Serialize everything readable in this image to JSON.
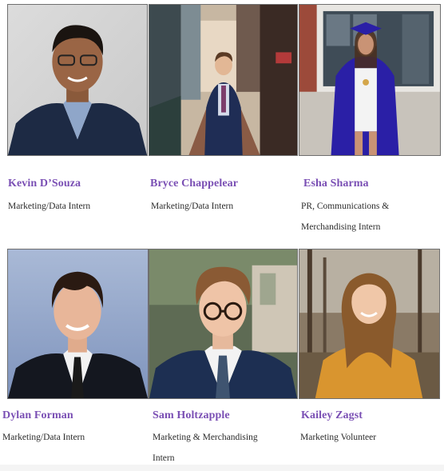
{
  "team": {
    "members": [
      {
        "name": "Kevin D’Souza",
        "role_lines": [
          "Marketing/Data Intern"
        ]
      },
      {
        "name": "Bryce Chappelear",
        "role_lines": [
          "Marketing/Data Intern"
        ]
      },
      {
        "name": "Esha Sharma",
        "role_lines": [
          "PR, Communications &",
          "Merchandising Intern"
        ]
      },
      {
        "name": "Dylan Forman",
        "role_lines": [
          "Marketing/Data Intern"
        ]
      },
      {
        "name": "Sam Holtzapple",
        "role_lines": [
          "Marketing & Merchandising",
          "Intern"
        ]
      },
      {
        "name": "Kailey Zagst",
        "role_lines": [
          "Marketing Volunteer"
        ]
      }
    ]
  },
  "colors": {
    "name_accent": "#7a4fb4",
    "role_text": "#2b2b2b",
    "photo_border": "#6f6f6f"
  }
}
